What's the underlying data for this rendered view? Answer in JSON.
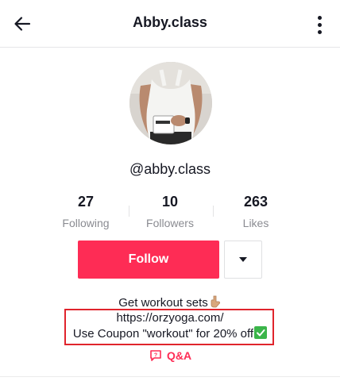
{
  "header": {
    "title": "Abby.class",
    "back_icon": "arrow-left-icon",
    "more_icon": "more-vertical-icon"
  },
  "profile": {
    "handle": "@abby.class",
    "avatar_icon": "avatar-photo"
  },
  "stats": [
    {
      "value": "27",
      "label": "Following"
    },
    {
      "value": "10",
      "label": "Followers"
    },
    {
      "value": "263",
      "label": "Likes"
    }
  ],
  "actions": {
    "follow_label": "Follow",
    "dropdown_icon": "caret-down-icon"
  },
  "bio": {
    "line1": "Get workout sets",
    "link": "https://orzyoga.com/",
    "line3": "Use Coupon \"workout\" for 20% off"
  },
  "qa": {
    "label": "Q&A",
    "icon": "question-bubble-icon"
  },
  "colors": {
    "accent": "#fe2c55",
    "highlight": "#e0242c",
    "text": "#161823",
    "muted": "#8a8b91"
  }
}
